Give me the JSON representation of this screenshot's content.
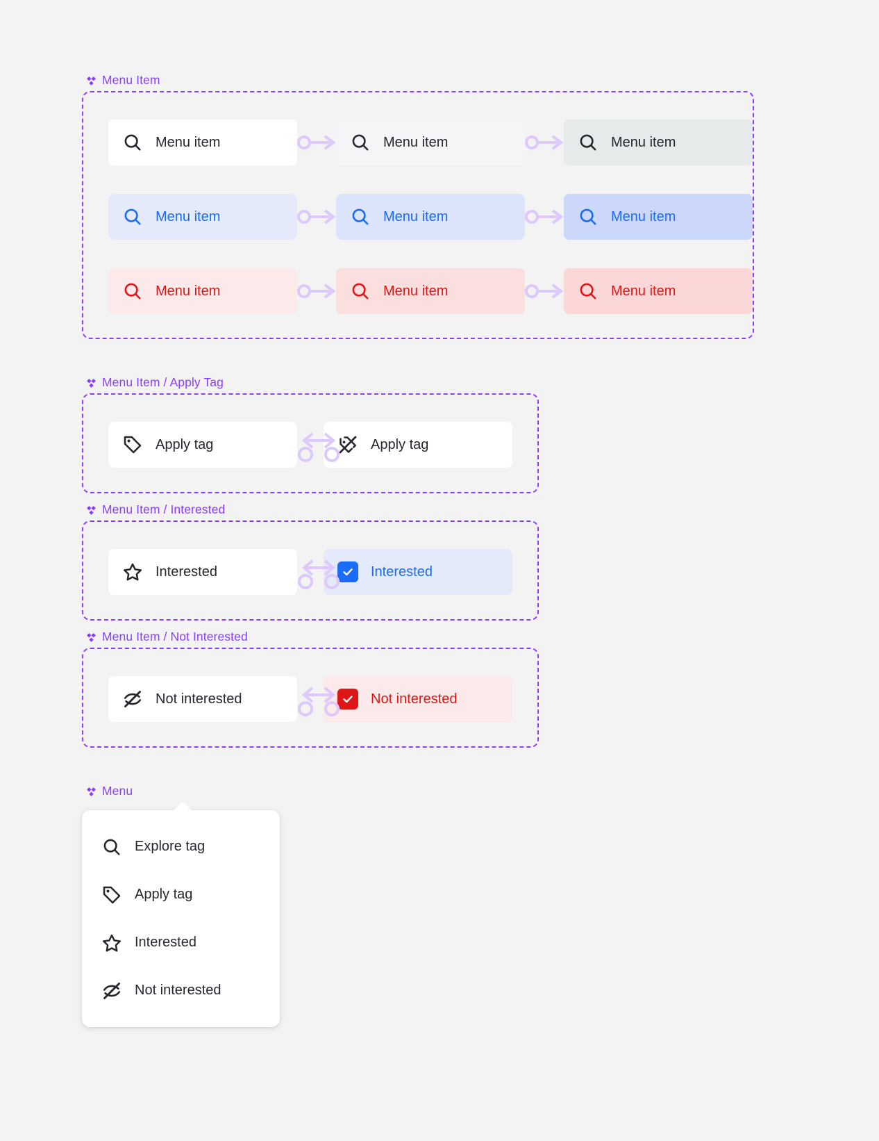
{
  "canvas": {
    "background": "#f3f3f3",
    "accent": "#8b3dff"
  },
  "palette": {
    "accent_purple": "#8b3dff",
    "connector_purple": "#ddc8fb",
    "text_dark": "#24272e",
    "blue": "#1a6bf5",
    "red": "#dd1616"
  },
  "sections": [
    {
      "id": "menu-item",
      "title": "Menu Item",
      "icon": "component-diamond-icon",
      "rows": [
        {
          "style": "default",
          "variants": [
            {
              "state": "default",
              "label": "Menu item",
              "icon": "search-icon",
              "bg": "#ffffff",
              "fg": "#24272e"
            },
            {
              "state": "hover",
              "label": "Menu item",
              "icon": "search-icon",
              "bg": "#f4f5f6",
              "fg": "#24272e"
            },
            {
              "state": "pressed",
              "label": "Menu item",
              "icon": "search-icon",
              "bg": "#e6eaeb",
              "fg": "#24272e"
            }
          ]
        },
        {
          "style": "selected",
          "variants": [
            {
              "state": "default",
              "label": "Menu item",
              "icon": "search-icon",
              "bg": "#e4eaf9",
              "fg": "#1a6bf5"
            },
            {
              "state": "hover",
              "label": "Menu item",
              "icon": "search-icon",
              "bg": "#dbe4fb",
              "fg": "#1a6bf5"
            },
            {
              "state": "pressed",
              "label": "Menu item",
              "icon": "search-icon",
              "bg": "#ccd8fb",
              "fg": "#1a6bf5"
            }
          ]
        },
        {
          "style": "danger",
          "variants": [
            {
              "state": "default",
              "label": "Menu item",
              "icon": "search-icon",
              "bg": "#fce9e9",
              "fg": "#dd1616"
            },
            {
              "state": "hover",
              "label": "Menu item",
              "icon": "search-icon",
              "bg": "#fbdede",
              "fg": "#dd1616"
            },
            {
              "state": "pressed",
              "label": "Menu item",
              "icon": "search-icon",
              "bg": "#fbd7d7",
              "fg": "#dd1616"
            }
          ]
        }
      ]
    },
    {
      "id": "menu-item-apply-tag",
      "title": "Menu Item / Apply Tag",
      "icon": "component-diamond-icon",
      "variants": [
        {
          "state": "off",
          "label": "Apply tag",
          "icon": "tag-icon",
          "bg": "#ffffff",
          "fg": "#24272e"
        },
        {
          "state": "on",
          "label": "Apply tag",
          "icon": "tag-off-icon",
          "bg": "#ffffff",
          "fg": "#24272e"
        }
      ]
    },
    {
      "id": "menu-item-interested",
      "title": "Menu Item / Interested",
      "icon": "component-diamond-icon",
      "variants": [
        {
          "state": "off",
          "label": "Interested",
          "icon": "star-icon",
          "bg": "#ffffff",
          "fg": "#24272e"
        },
        {
          "state": "on",
          "label": "Interested",
          "icon": "checkbox-checked-icon",
          "bg": "#e4eaf9",
          "fg": "#1a6bf5"
        }
      ]
    },
    {
      "id": "menu-item-not-interested",
      "title": "Menu Item / Not Interested",
      "icon": "component-diamond-icon",
      "variants": [
        {
          "state": "off",
          "label": "Not interested",
          "icon": "eye-off-icon",
          "bg": "#ffffff",
          "fg": "#24272e"
        },
        {
          "state": "on",
          "label": "Not interested",
          "icon": "checkbox-checked-icon",
          "bg": "#fce9e9",
          "fg": "#dd1616"
        }
      ]
    }
  ],
  "menu": {
    "title": "Menu",
    "icon": "component-diamond-icon",
    "items": [
      {
        "label": "Explore tag",
        "icon": "search-icon"
      },
      {
        "label": "Apply tag",
        "icon": "tag-icon"
      },
      {
        "label": "Interested",
        "icon": "star-icon"
      },
      {
        "label": "Not interested",
        "icon": "eye-off-icon"
      }
    ]
  }
}
